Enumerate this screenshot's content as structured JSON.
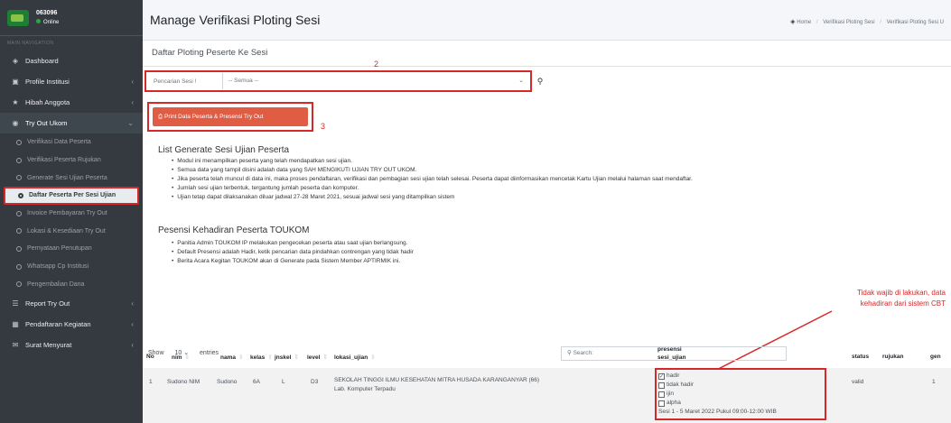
{
  "sidebar": {
    "user_id": "063096",
    "status": "Online",
    "nav_header": "MAIN NAVIGATION",
    "items": {
      "dashboard": "Dashboard",
      "profile": "Profile Institusi",
      "hibah": "Hibah Anggota",
      "tryout": "Try Out Ukom",
      "report": "Report Try Out",
      "pendaftaran": "Pendaftaran Kegiatan",
      "surat": "Surat Menyurat"
    },
    "subitems": [
      "Verifikasi Data Peserta",
      "Verifikasi Peserta Rujukan",
      "Generate Sesi Ujian Peserta",
      "Daftar Peserta Per Sesi Ujian",
      "Invoice Pembayaran Try Out",
      "Lokasi & Kesediaan Try Out",
      "Pernyataan Penutupan",
      "Whatsapp Cp Institusi",
      "Pengembalian Dana"
    ]
  },
  "header": {
    "title": "Manage Verifikasi Ploting Sesi",
    "breadcrumb": [
      "Home",
      "Verifikasi Ploting Sesi",
      "Verifikasi Ploting Sesi U"
    ]
  },
  "card": {
    "title": "Daftar Ploting Peserte Ke Sesi",
    "search_label": "Pencarian Sesi !",
    "search_value": "-- Semua --",
    "print_label": "Print Data Peserta & Presensi Try Out",
    "annot_2": "2",
    "annot_3": "3"
  },
  "list_section": {
    "title": "List Generate Sesi Ujian Peserta",
    "bullets": [
      "Modul ini menampilkan peserta yang telah mendapatkan sesi ujian.",
      "Semua data yang tampil disini adalah data yang SAH MENGIKUTI UJIAN TRY OUT UKOM.",
      "Jika peserta telah muncul di data ini, maka proses pendaftaran, verifikasi dan pembagian sesi ujian telah selesai. Peserta dapat diinformasikan mencetak Kartu Ujian melalui halaman saat mendaftar.",
      "Jumlah sesi ujian terbentuk, tergantung jumlah peserta dan komputer.",
      "Ujian tetap dapat dilaksanakan diluar jadwal 27-28 Maret 2021, sesuai jadwal sesi yang ditampilkan sistem"
    ]
  },
  "presensi_section": {
    "title": "Pesensi Kehadiran Peserta TOUKOM",
    "bullets": [
      "Panitia Admin TOUKOM IP melakukan pengecekan peserta atau saat ujian berlangsung.",
      "Default Presensi adalah Hadir, ketik pencarian data pindahkan contrengan yang tidak hadir",
      "Berita Acara Kegitan TOUKOM akan di Generate pada Sistem Member APTIRMIK ini."
    ]
  },
  "annotation": {
    "line1": "Tidak wajib di lakukan, data",
    "line2": "kehadiran dari sistem CBT"
  },
  "datatable": {
    "show_label": "Show",
    "entries_value": "10",
    "entries_label": "entries",
    "search_placeholder": "Search:",
    "columns": {
      "no": "No",
      "nim": "nim",
      "nama": "nama",
      "kelas": "kelas",
      "jnskel": "jnskel",
      "level": "level",
      "lokasi": "lokasi_ujian",
      "presensi1": "presensi",
      "presensi2": "sesi_ujian",
      "status": "status",
      "rujukan": "rujukan",
      "gen": "gen"
    },
    "row": {
      "no": "1",
      "nim": "Sudono NIM",
      "nama": "Sudono",
      "kelas": "6A",
      "jnskel": "L",
      "level": "D3",
      "lokasi1": "SEKOLAH TINGGI ILMU KESEHATAN MITRA HUSADA KARANGANYAR (66)",
      "lokasi2": "Lab. Komputer Terpadu",
      "presensi_options": [
        "hadir",
        "tidak hadir",
        "ijin",
        "alpha"
      ],
      "sesi": "Sesi 1 - 5 Maret 2022 Pukul 09:00-12:00 WIB",
      "status": "valid",
      "gen": "1"
    }
  }
}
